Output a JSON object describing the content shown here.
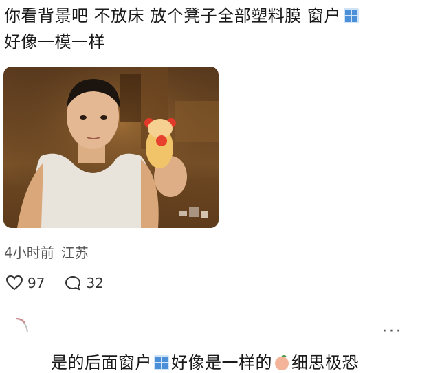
{
  "post": {
    "line1": "你看背景吧 不放床 放个凳子全部塑料膜 窗户",
    "line2": "好像一模一样",
    "time": "4小时前",
    "location": "江苏",
    "likes": "97",
    "comments": "32"
  },
  "next_post": {
    "text_a": "是的后面窗户",
    "text_b": "好像是一样的",
    "text_c": "细思极恐"
  },
  "icons": {
    "window": "window-emoji-icon",
    "heart": "heart-icon",
    "comment": "comment-bubble-icon",
    "more": "more-dots-icon",
    "peach": "peach-emoji-icon"
  },
  "colors": {
    "text": "#1a1a1a",
    "meta": "#555555",
    "window_blue": "#4a8fd8"
  }
}
